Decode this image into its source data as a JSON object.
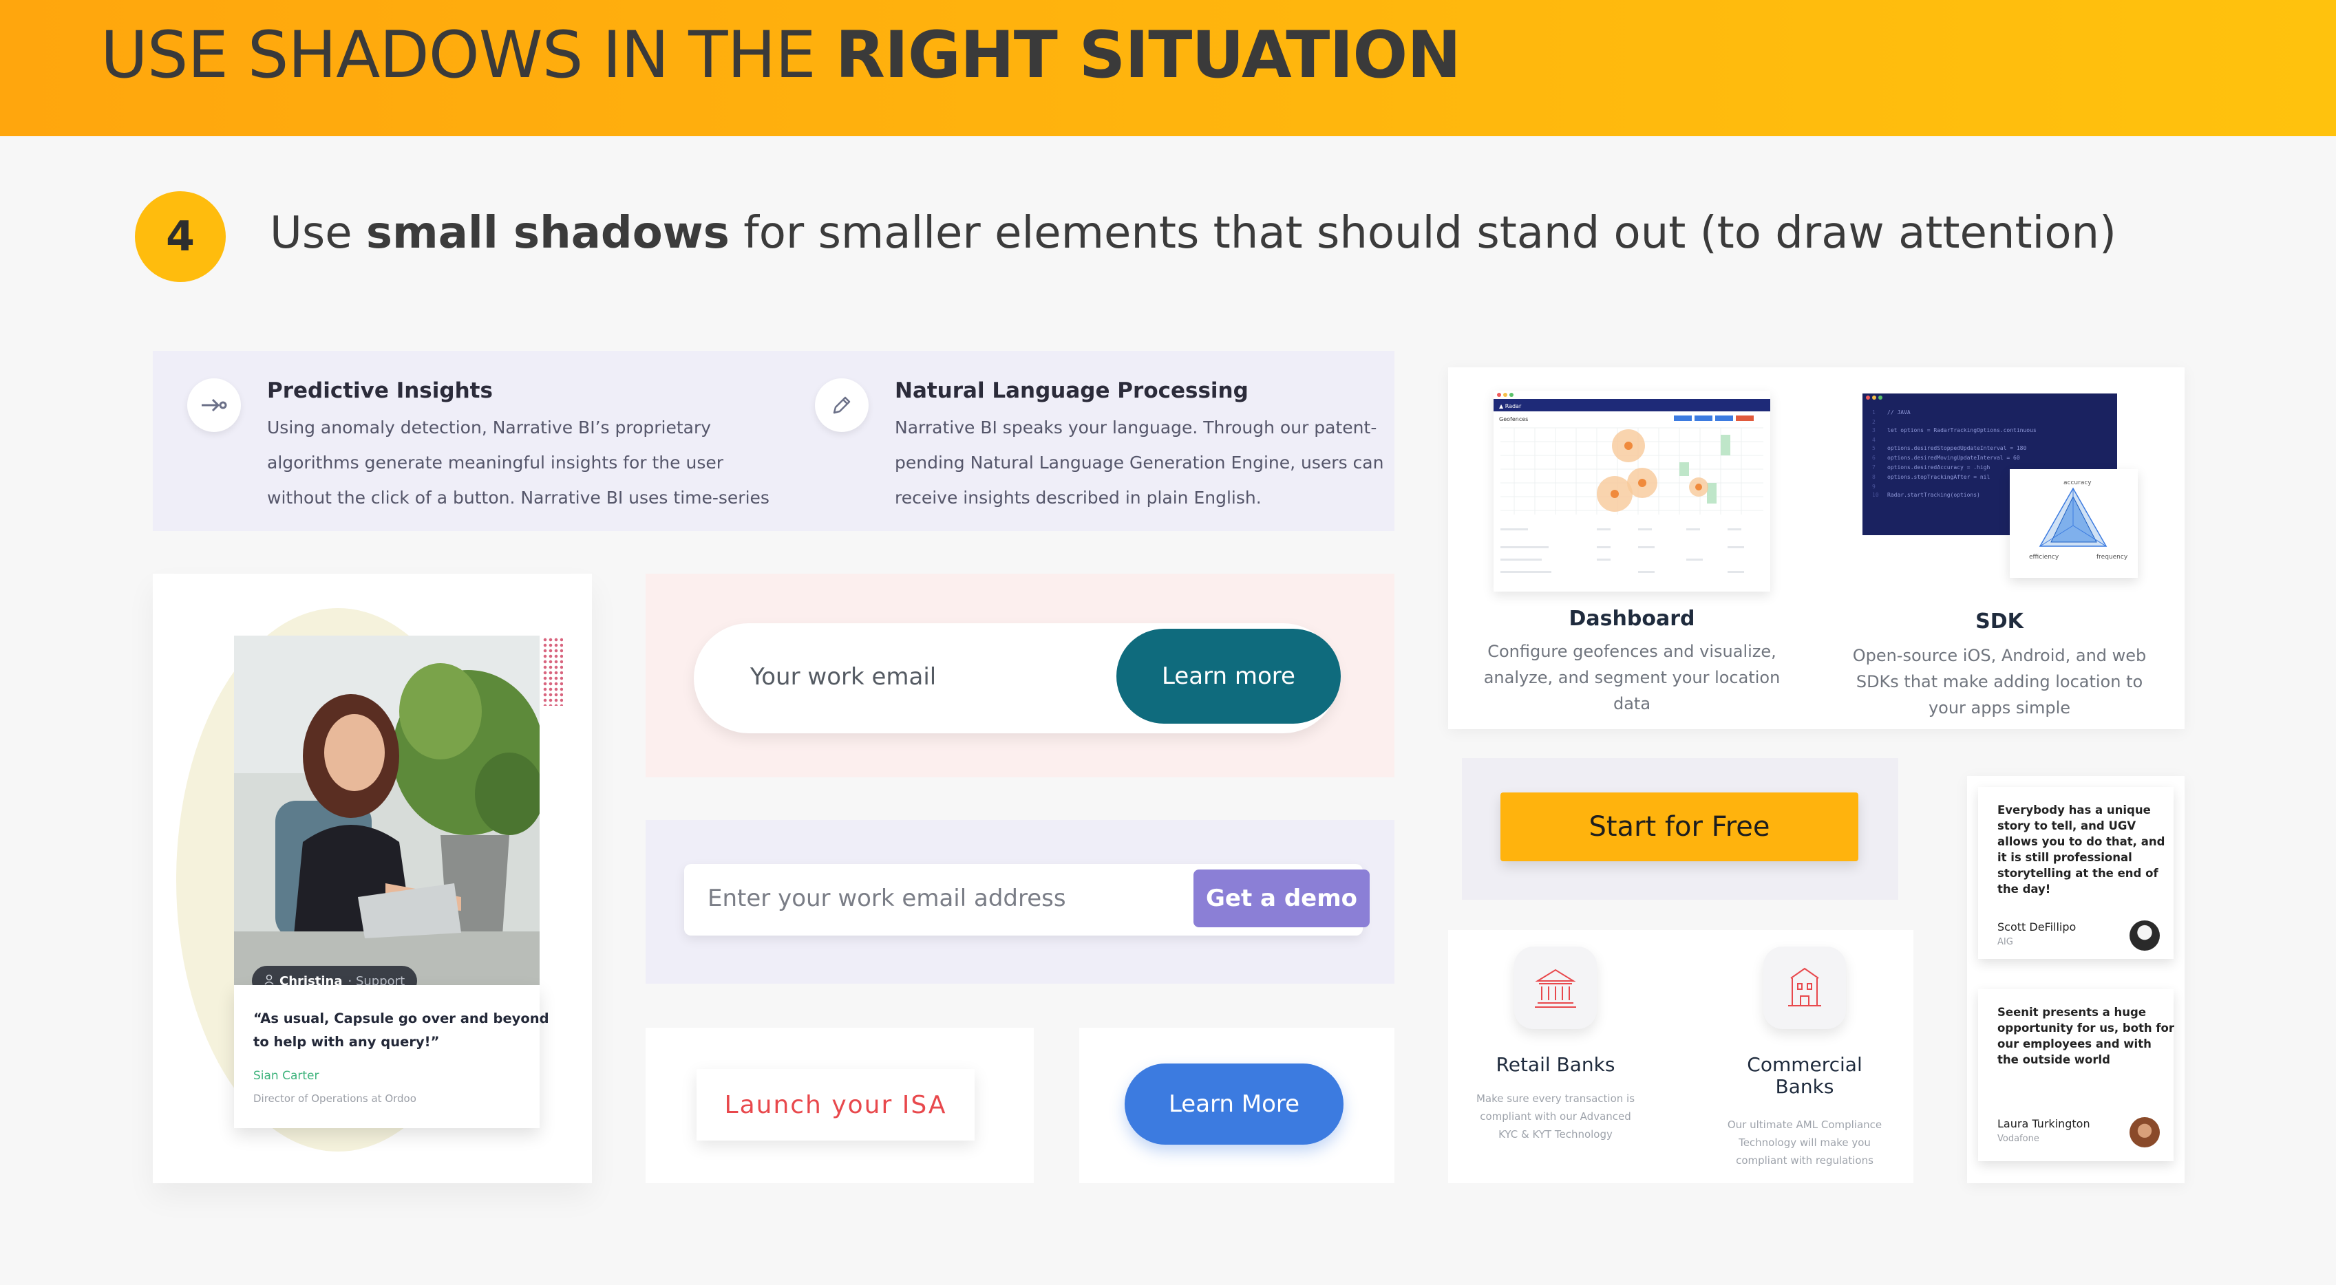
{
  "header": {
    "title_regular": "USE SHADOWS IN THE ",
    "title_bold": "RIGHT SITUATION"
  },
  "step": {
    "number": "4",
    "text_prefix": "Use ",
    "text_bold": "small shadows",
    "text_suffix": " for smaller elements that should stand out (to draw attention)"
  },
  "insights": [
    {
      "icon": "arrow-right-icon",
      "title": "Predictive Insights",
      "lines": [
        "Using anomaly detection, Narrative BI’s proprietary",
        "algorithms generate meaningful insights for the user",
        "without the click of a button. Narrative BI uses time-series"
      ]
    },
    {
      "icon": "pencil-icon",
      "title": "Natural Language Processing",
      "lines": [
        "Narrative BI speaks your language. Through our patent-",
        "pending Natural Language Generation Engine, users can",
        "receive insights described in plain English."
      ]
    }
  ],
  "testimonial": {
    "badge_name": "Christina",
    "badge_role": " · Support",
    "quote_line1": "“As usual, Capsule go over and beyond",
    "quote_line2": "to help with any query!”",
    "author": "Sian Carter",
    "author_title": "Director of Operations at Ordoo"
  },
  "email_signup": {
    "placeholder": "Your work email",
    "button": "Learn more"
  },
  "demo_signup": {
    "placeholder": "Enter your work email address",
    "button": "Get a demo"
  },
  "isa": {
    "button": "Launch your ISA"
  },
  "learn_more_2": {
    "button": "Learn More"
  },
  "features": {
    "dashboard": {
      "title": "Dashboard",
      "lines": [
        "Configure geofences and visualize,",
        "analyze, and segment your location",
        "data"
      ],
      "mock_brand": "Radar",
      "mock_heading": "Geofences"
    },
    "sdk": {
      "title": "SDK",
      "lines": [
        "Open-source iOS, Android, and web",
        "SDKs that make adding location to",
        "your apps simple"
      ],
      "code_lines": [
        "// JAVA",
        "let options = RadarTrackingOptions.continuous",
        "",
        "options.desiredStoppedUpdateInterval = 180",
        "options.desiredMovingUpdateInterval = 60",
        "options.desiredAccuracy = .high",
        "options.stopTrackingAfter = nil",
        "",
        "Radar.startTracking(options)"
      ],
      "radar_labels": [
        "accuracy",
        "efficiency",
        "frequency"
      ]
    }
  },
  "start_free": {
    "button": "Start for Free"
  },
  "banks": [
    {
      "title_lines": [
        "Retail Banks"
      ],
      "lines": [
        "Make sure every transaction is",
        "compliant with our Advanced",
        "KYC & KYT Technology"
      ]
    },
    {
      "title_lines": [
        "Commercial",
        "Banks"
      ],
      "lines": [
        "Our ultimate AML Compliance",
        "Technology will make you",
        "compliant with regulations"
      ]
    }
  ],
  "quotes": [
    {
      "lines": [
        "Everybody has a unique",
        "story to tell, and UGV",
        "allows you to do that, and",
        "it is still professional",
        "storytelling at the end of",
        "the day!"
      ],
      "name": "Scott DeFillipo",
      "org": "AIG"
    },
    {
      "lines": [
        "Seenit presents a huge",
        "opportunity for us, both for",
        "our employees and with",
        "the outside world"
      ],
      "name": "Laura Turkington",
      "org": "Vodafone"
    }
  ],
  "colors": {
    "banner": "#ffb30d",
    "step_circle": "#ffbc0d",
    "teal_button": "#0f6b7d",
    "purple_button": "#8b7fd6",
    "blue_button": "#3c7be0",
    "red_text": "#e8484c",
    "orange_button": "#ffb30d"
  }
}
